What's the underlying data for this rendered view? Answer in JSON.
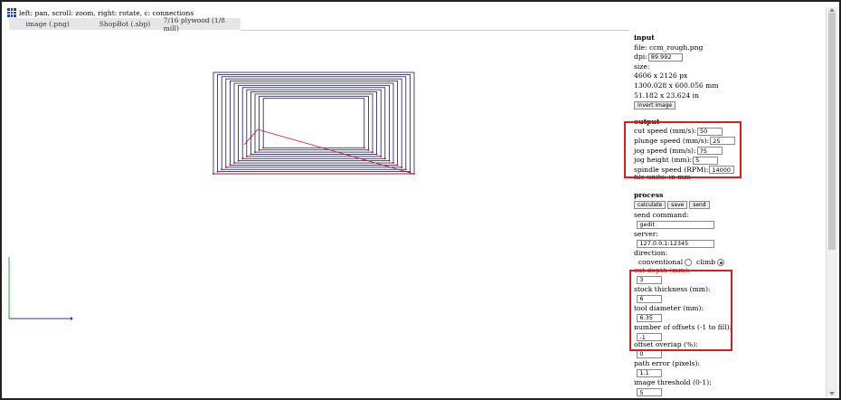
{
  "topbar": {
    "hint": "left: pan, scroll: zoom, right: rotate, c: connections"
  },
  "tabs": [
    {
      "label": "image (.png)"
    },
    {
      "label": "ShopBot (.sbp)"
    },
    {
      "label": "7/16 plywood (1/8 mill)"
    }
  ],
  "input": {
    "heading": "input",
    "file": "file: ccm_rough.png",
    "dpi_label": "dpi:",
    "dpi_value": "89.992",
    "size_label": "size:",
    "size_px": "4606 x 2126 px",
    "size_mm": "1300.028 x 600.056 mm",
    "size_in": "51.182 x 23.624 in",
    "invert_button": "invert image"
  },
  "output": {
    "heading": "output",
    "cut_speed_label": "cut speed (mm/s):",
    "cut_speed": "50",
    "plunge_speed_label": "plunge speed (mm/s):",
    "plunge_speed": "25",
    "jog_speed_label": "jog speed (mm/s):",
    "jog_speed": "75",
    "jog_height_label": "jog height (mm):",
    "jog_height": "5",
    "spindle_label": "spindle speed (RPM):",
    "spindle": "14000",
    "units_partial": "file units: in    mm"
  },
  "process": {
    "heading": "process",
    "calculate_button": "calculate",
    "save_button": "save",
    "send_button": "send",
    "send_command_label": "send command:",
    "send_command": "gedit",
    "server_label": "server:",
    "server": "127.0.0.1:12345",
    "direction_label": "direction:",
    "conventional": "conventional",
    "climb": "climb",
    "cut_depth_label": "cut depth (mm):",
    "cut_depth": "3",
    "stock_label": "stock thickness (mm):",
    "stock": "6",
    "tool_label": "tool diameter (mm):",
    "tool": "6.35",
    "offsets_label": "number of offsets (-1 to fill):",
    "offsets": "-1",
    "overlap_label": "offset overlap (%):",
    "overlap": "0",
    "path_error_label": "path error (pixels):",
    "path_error": "1.1",
    "threshold_label": "image threshold (0-1):",
    "threshold": "5"
  },
  "colors": {
    "highlight": "#d0202a",
    "path": "#1a1a4a",
    "cutpath": "#c0102a",
    "axis_x": "#3030c0",
    "axis_y": "#30a030"
  }
}
